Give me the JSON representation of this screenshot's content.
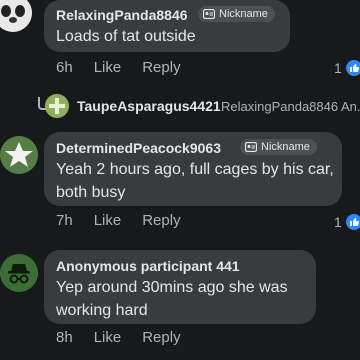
{
  "colors": {
    "background": "#18191a",
    "bubble": "#3a3b3c",
    "like_blue": "#2d88ff",
    "muted": "#b0b3b8"
  },
  "comments": [
    {
      "author": "RelaxingPanda8846",
      "badge": "Nickname",
      "text": [
        "Loads of tat outside"
      ],
      "time": "6h",
      "like": "Like",
      "reply": "Reply",
      "reaction_count": "1"
    },
    {
      "author": "DeterminedPeacock9063",
      "badge": "Nickname",
      "text": [
        "Yeah 2 hours ago, full cages by his car,",
        "both busy"
      ],
      "time": "7h",
      "like": "Like",
      "reply": "Reply",
      "reaction_count": "1"
    },
    {
      "author": "Anonymous participant 441",
      "text": [
        "Yep around 30mins ago she was",
        "working hard"
      ],
      "time": "8h",
      "like": "Like",
      "reply": "Reply"
    }
  ],
  "reply_preview": {
    "author": "TaupeAsparagus4421",
    "snippet": "RelaxingPanda8846 An..."
  },
  "icons": {
    "badge": "badge-icon",
    "reply_arrow": "reply-arrow-icon",
    "like": "thumbs-up-icon",
    "anonymous": "incognito-icon"
  }
}
